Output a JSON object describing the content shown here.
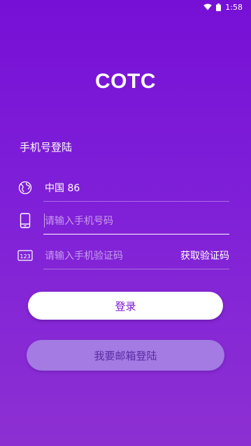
{
  "status_bar": {
    "time": "1:58"
  },
  "app": {
    "title": "COTC"
  },
  "form": {
    "section_title": "手机号登陆",
    "country": {
      "value": "中国 86",
      "icon": "globe-icon"
    },
    "phone": {
      "placeholder": "请输入手机号码",
      "icon": "phone-icon"
    },
    "code": {
      "placeholder": "请输入手机验证码",
      "icon": "numeric-keypad-icon",
      "get_code_label": "获取验证码"
    }
  },
  "buttons": {
    "login_label": "登录",
    "email_login_label": "我要邮箱登陆"
  },
  "colors": {
    "background_top": "#7710D6",
    "background_bottom": "#8D30D2",
    "login_button_text": "#7A16D6",
    "email_button_bg": "#A37BE3"
  }
}
